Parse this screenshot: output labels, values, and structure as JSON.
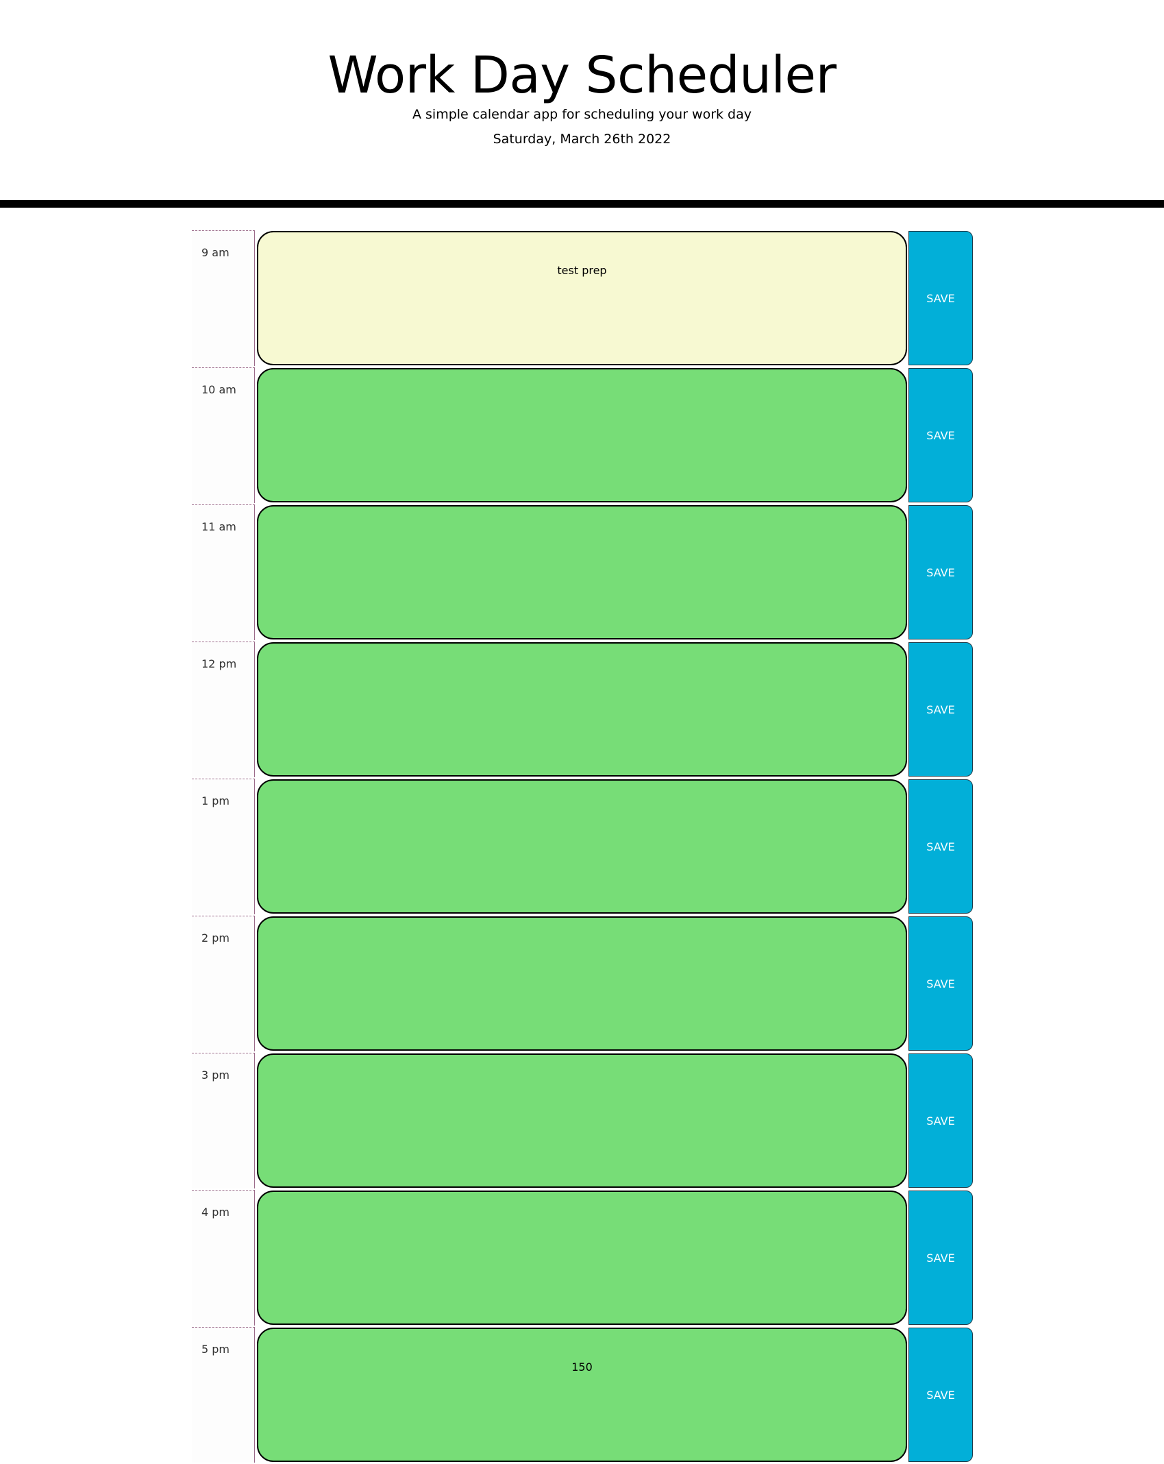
{
  "header": {
    "title": "Work Day Scheduler",
    "subtitle": "A simple calendar app for scheduling your work day",
    "current_date": "Saturday, March 26th 2022"
  },
  "colors": {
    "present": "#f7f9d2",
    "future": "#77dd77",
    "save_button": "#02afd8",
    "divider": "#000000"
  },
  "time_blocks": [
    {
      "hour": "9 am",
      "text": "test prep",
      "state": "present",
      "save_label": "SAVE"
    },
    {
      "hour": "10 am",
      "text": "",
      "state": "future",
      "save_label": "SAVE"
    },
    {
      "hour": "11 am",
      "text": "",
      "state": "future",
      "save_label": "SAVE"
    },
    {
      "hour": "12 pm",
      "text": "",
      "state": "future",
      "save_label": "SAVE"
    },
    {
      "hour": "1 pm",
      "text": "",
      "state": "future",
      "save_label": "SAVE"
    },
    {
      "hour": "2 pm",
      "text": "",
      "state": "future",
      "save_label": "SAVE"
    },
    {
      "hour": "3 pm",
      "text": "",
      "state": "future",
      "save_label": "SAVE"
    },
    {
      "hour": "4 pm",
      "text": "",
      "state": "future",
      "save_label": "SAVE"
    },
    {
      "hour": "5 pm",
      "text": "150",
      "state": "future",
      "save_label": "SAVE"
    }
  ]
}
